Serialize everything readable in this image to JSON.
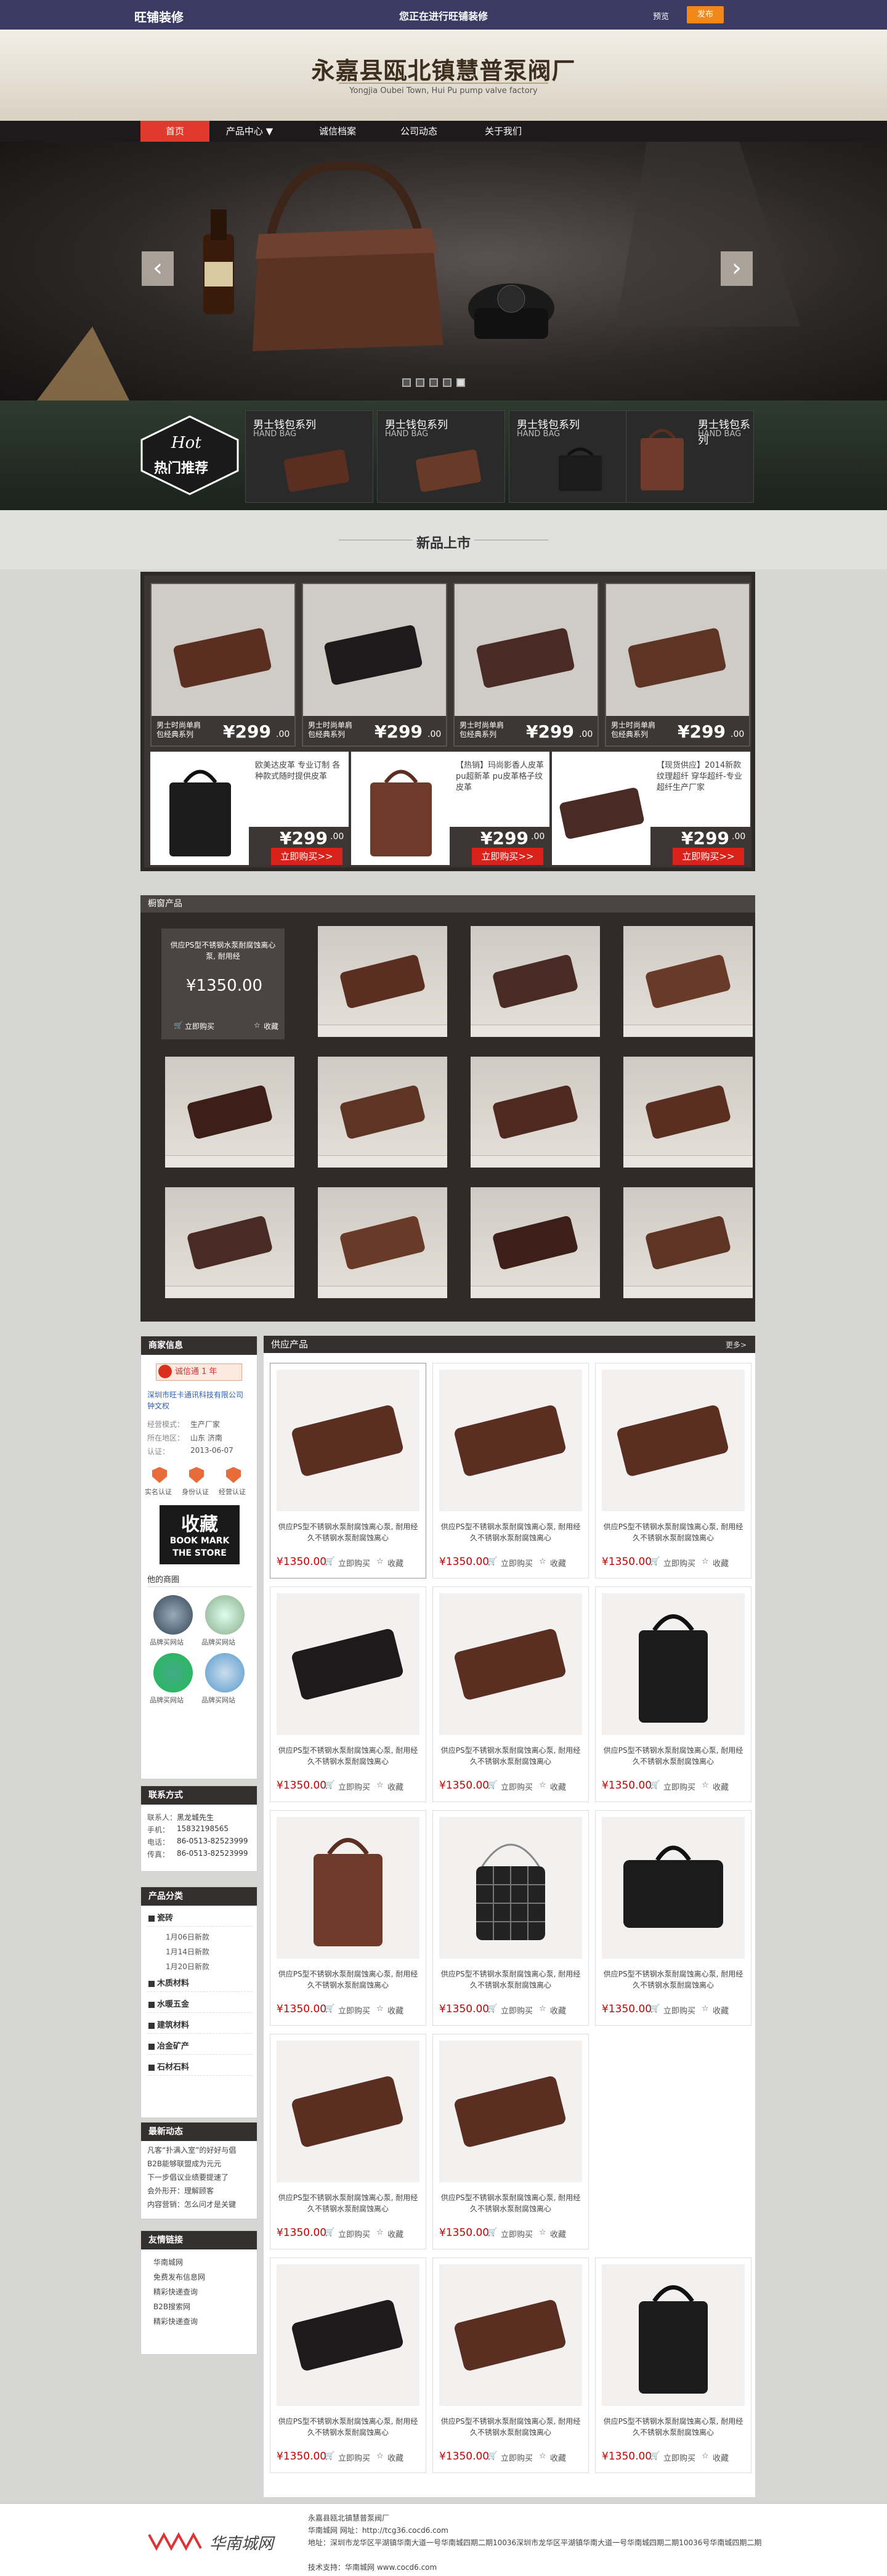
{
  "topbar": {
    "brand": "旺铺装修",
    "message": "您正在进行旺铺装修",
    "preview": "预览",
    "publish": "发布"
  },
  "header": {
    "title": "永嘉县瓯北镇慧普泵阀厂",
    "subtitle": "Yongjia Oubei Town, Hui Pu pump valve factory"
  },
  "nav": {
    "items": [
      {
        "label": "首页"
      },
      {
        "label": "产品中心 ▼"
      },
      {
        "label": "诚信档案"
      },
      {
        "label": "公司动态"
      },
      {
        "label": "关于我们"
      }
    ]
  },
  "banner": {
    "prev": "‹",
    "next": "›"
  },
  "hot": {
    "badge_top": "Hot",
    "badge_bottom": "热门推荐",
    "cards": [
      {
        "title": "男士钱包系列",
        "sub": "HAND BAG"
      },
      {
        "title": "男士钱包系列",
        "sub": "HAND BAG"
      },
      {
        "title": "男士钱包系列",
        "sub": "HAND BAG"
      },
      {
        "title": "男士钱包系列",
        "sub": "HAND BAG"
      }
    ]
  },
  "new_section": {
    "title": "新品上市",
    "row1": [
      {
        "cap": "男士时尚单肩包经典系列",
        "price": "¥299",
        "cents": ".00"
      },
      {
        "cap": "男士时尚单肩包经典系列",
        "price": "¥299",
        "cents": ".00"
      },
      {
        "cap": "男士时尚单肩包经典系列",
        "price": "¥299",
        "cents": ".00"
      },
      {
        "cap": "男士时尚单肩包经典系列",
        "price": "¥299",
        "cents": ".00"
      }
    ],
    "row2": [
      {
        "desc": "欧美达皮革 专业订制 各种款式随时提供皮革",
        "price": "¥299",
        "cents": ".00",
        "buy": "立即购买>>"
      },
      {
        "desc": "【热销】玛尚影香人皮革 pu超新革 pu皮革格子纹皮革",
        "price": "¥299",
        "cents": ".00",
        "buy": "立即购买>>"
      },
      {
        "desc": "【现货供应】2014新款纹理超纤 穿华超纤-专业超纤生产厂家",
        "price": "¥299",
        "cents": ".00",
        "buy": "立即购买>>"
      }
    ]
  },
  "showcase": {
    "header": "橱窗产品",
    "feature": {
      "name": "供应PS型不锈钢水泵耐腐蚀离心泵, 耐用经",
      "price": "¥1350.00",
      "buy": "立即购买",
      "fav": "收藏"
    }
  },
  "merchant": {
    "header": "商家信息",
    "badge": "诚信通 1 年",
    "company": "深圳市旺卡通讯科技有限公司",
    "contact": "钟文权",
    "rows": [
      {
        "k": "经营模式：",
        "v": "生产厂家"
      },
      {
        "k": "所在地区：",
        "v": "山东 济南"
      },
      {
        "k": "认证：",
        "v": "2013-06-07"
      }
    ],
    "certs": [
      "实名认证",
      "身份认证",
      "经营认证"
    ],
    "stamp": "收藏",
    "stamp_en1": "BOOK MARK",
    "stamp_en2": "THE STORE",
    "shops_title": "他的商圈",
    "shops": [
      "品牌买网站",
      "品牌买网站",
      "品牌买网站",
      "品牌买网站"
    ]
  },
  "contact": {
    "header": "联系方式",
    "rows": [
      {
        "k": "联系人：",
        "v": "黑龙城先生"
      },
      {
        "k": "手机：",
        "v": "15832198565"
      },
      {
        "k": "电话：",
        "v": "86-0513-82523999"
      },
      {
        "k": "传真：",
        "v": "86-0513-82523999"
      }
    ]
  },
  "categories": {
    "header": "产品分类",
    "groups": [
      {
        "name": "瓷砖",
        "subs": [
          "1月06日新款",
          "1月14日新款",
          "1月20日新款"
        ]
      },
      {
        "name": "木质材料",
        "subs": []
      },
      {
        "name": "水暖五金",
        "subs": []
      },
      {
        "name": "建筑材料",
        "subs": []
      },
      {
        "name": "冶金矿产",
        "subs": []
      },
      {
        "name": "石材石料",
        "subs": []
      }
    ]
  },
  "news": {
    "header": "最新动态",
    "items": [
      "凡客“扑满入室”的好好与倡",
      "B2B能够联盟成为元元",
      "下一步倡议业绩要提速了",
      "会外形开：理解顾客",
      "内容营销：怎么问才是关键"
    ]
  },
  "links": {
    "header": "友情链接",
    "items": [
      "华南城网",
      "免费发布信息网",
      "精彩快递查询",
      "B2B搜索网",
      "精彩快递查询"
    ]
  },
  "grid": {
    "header": "供应产品",
    "more": "更多>",
    "item_name": "供应PS型不锈钢水泵耐腐蚀离心泵, 耐用经久不锈钢水泵耐腐蚀离心",
    "price": "¥1350.00",
    "buy": "立即购买",
    "fav": "收藏",
    "kinds": [
      "wallet",
      "wallet",
      "wallet",
      "wallet-black",
      "wallet",
      "bag-black",
      "bag-brown",
      "bag-quilt",
      "bag-black2",
      "wallet",
      "wallet",
      "",
      "wallet-black",
      "wallet",
      "bag-black"
    ]
  },
  "footer": {
    "logo": "华南城网",
    "line1": "永嘉县瓯北镇慧普泵阀厂",
    "line2": "华南城网    网址：http://tcg36.cocd6.com",
    "line3": "地址：深圳市龙华区平湖镇华南大道一号华南城四期二期10036深圳市龙华区平湖镇华南大道一号华南城四期二期10036号华南城四期二期",
    "line4": "技术支持：华南城网    www.cocd6.com"
  }
}
